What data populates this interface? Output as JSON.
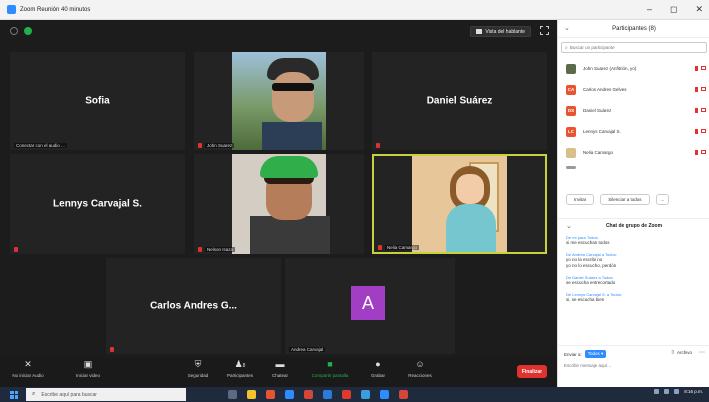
{
  "window": {
    "title": "Zoom Reunión 40 minutos",
    "controls": [
      "–",
      "◻",
      "✕"
    ]
  },
  "view_button": {
    "label": "Vista del hablante"
  },
  "tiles": [
    {
      "id": "sofia",
      "display_name": "Sofia",
      "caption": "Conectar con el audio ..."
    },
    {
      "id": "john",
      "caption": "John Suarez"
    },
    {
      "id": "daniel",
      "display_name": "Daniel Suárez",
      "caption": ""
    },
    {
      "id": "lennys",
      "display_name": "Lennys Carvajal S.",
      "caption": ""
    },
    {
      "id": "nelson",
      "caption": "Nelson Isaza"
    },
    {
      "id": "nelia",
      "caption": "Nelia Camargo"
    },
    {
      "id": "carlos",
      "display_name": "Carlos Andres G...",
      "caption": ""
    },
    {
      "id": "andrea",
      "avatar_letter": "A",
      "avatar_color": "#a13ec3",
      "caption": "Andrea Carvajal"
    }
  ],
  "toolbar": {
    "audio": "No iniciar Audio",
    "video": "Iniciar video",
    "security": "Seguridad",
    "participants": "Participantes",
    "participants_count": "8",
    "chat": "Chatear",
    "share": "Compartir pantalla",
    "record": "Grabar",
    "reactions": "Reacciones",
    "end": "Finalizar"
  },
  "participants_panel": {
    "title": "Participantes (8)",
    "search_placeholder": "Buscar un participante",
    "participants": [
      {
        "name": "John Suarez (Anfitrión, yo)",
        "initials": "",
        "color": "#5a6a4a"
      },
      {
        "name": "Carlos Andres Gelves",
        "initials": "CA",
        "color": "#e8542f"
      },
      {
        "name": "Daniel Suárez",
        "initials": "DS",
        "color": "#e8542f"
      },
      {
        "name": "Lennys Carvajal S.",
        "initials": "LC",
        "color": "#e8542f"
      },
      {
        "name": "Nelia Camargo",
        "initials": "",
        "color": "#d8c08a"
      }
    ],
    "invite_label": "Invitar",
    "mute_all_label": "Silenciar a todos",
    "more_label": "..."
  },
  "chat_panel": {
    "title": "Chat de grupo de Zoom",
    "messages": [
      {
        "from": "De mí para Todos:",
        "text": "si me escuchan todos"
      },
      {
        "from": "De Andrea Carvajal a Todos:",
        "text": "yo no la escribi no\nyo no lo escucho, perdón"
      },
      {
        "from": "De Daniel Suárez a Todos:",
        "text": "se escucha entrecortado"
      },
      {
        "from": "De Lennys Carvajal S. a Todos:",
        "text": "si, se escucha bien"
      }
    ],
    "send_to_label": "Enviar a:",
    "send_to_value": "Todos ▾",
    "files_label": "Archivo",
    "input_placeholder": "Escribir mensaje aquí..."
  },
  "taskbar": {
    "search_placeholder": "Escribe aquí para buscar",
    "time": "8:16 p.m."
  },
  "colors": {
    "active_speaker": "#c7d23a",
    "share_green": "#21b14b",
    "end_red": "#e0322f",
    "link_blue": "#2d8cff"
  }
}
